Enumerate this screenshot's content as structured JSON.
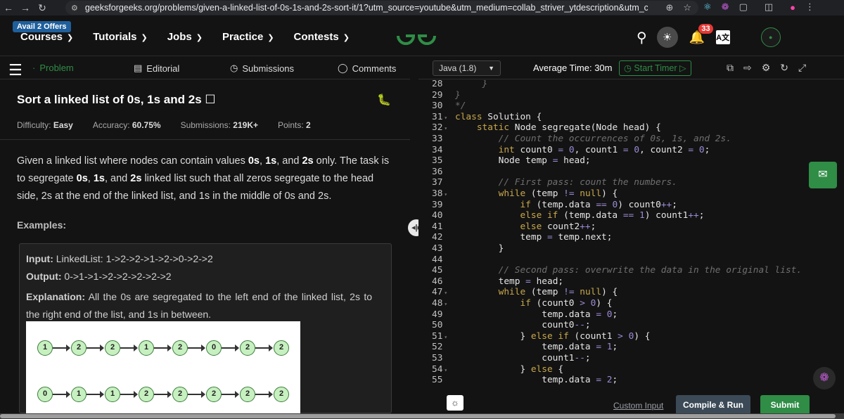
{
  "browser": {
    "url": "geeksforgeeks.org/problems/given-a-linked-list-of-0s-1s-and-2s-sort-it/1?utm_source=youtube&utm_medium=collab_striver_ytdescription&utm_campaign=given-a..."
  },
  "header": {
    "offers_label": "Avail 2 Offers",
    "menu": [
      "Courses",
      "Tutorials",
      "Jobs",
      "Practice",
      "Contests"
    ],
    "logo_text": "GfG",
    "notification_count": "33",
    "language_label": "A文"
  },
  "problem_tabs": {
    "problem": "Problem",
    "editorial": "Editorial",
    "submissions": "Submissions",
    "comments": "Comments"
  },
  "problem": {
    "title": "Sort a linked list of 0s, 1s and 2s",
    "difficulty_label": "Difficulty:",
    "difficulty_value": "Easy",
    "accuracy_label": "Accuracy:",
    "accuracy_value": "60.75%",
    "submissions_label": "Submissions:",
    "submissions_value": "219K+",
    "points_label": "Points:",
    "points_value": "2",
    "description": [
      {
        "t": "Given a linked list where nodes can contain values ",
        "b": false
      },
      {
        "t": "0s",
        "b": true
      },
      {
        "t": ", ",
        "b": false
      },
      {
        "t": "1s",
        "b": true
      },
      {
        "t": ", and ",
        "b": false
      },
      {
        "t": "2s",
        "b": true
      },
      {
        "t": " only. The task is to segregate ",
        "b": false
      },
      {
        "t": "0s",
        "b": true
      },
      {
        "t": ", ",
        "b": false
      },
      {
        "t": "1s",
        "b": true
      },
      {
        "t": ", and ",
        "b": false
      },
      {
        "t": "2s",
        "b": true
      },
      {
        "t": " linked list such that all zeros segregate to the head side, 2s at the end of the linked list, and 1s in the middle of 0s and 2s.",
        "b": false
      }
    ],
    "examples_label": "Examples:",
    "example": {
      "input_label": "Input:",
      "input_value": "LinkedList: 1->2->2->1->2->0->2->2",
      "output_label": "Output:",
      "output_value": "0->1->1->2->2->2->2->2",
      "explanation_label": "Explanation:",
      "explanation_value": "All the 0s are segregated to the left end of the linked list, 2s to the right end of the list, and 1s in between.",
      "row1": [
        "1",
        "2",
        "2",
        "1",
        "2",
        "0",
        "2",
        "2"
      ],
      "row2": [
        "0",
        "1",
        "1",
        "2",
        "2",
        "2",
        "2",
        "2"
      ]
    }
  },
  "editor": {
    "language": "Java (1.8)",
    "average_time": "Average Time: 30m",
    "start_timer": "Start Timer",
    "custom_input": "Custom Input",
    "compile_run": "Compile & Run",
    "submit": "Submit",
    "lines": [
      {
        "n": "28",
        "fold": false,
        "code": [
          {
            "c": "     }",
            "k": "cm"
          }
        ]
      },
      {
        "n": "29",
        "fold": false,
        "code": [
          {
            "c": "}",
            "k": "cm"
          }
        ]
      },
      {
        "n": "30",
        "fold": false,
        "code": [
          {
            "c": "*/",
            "k": "cm"
          }
        ]
      },
      {
        "n": "31",
        "fold": true,
        "code": [
          {
            "c": "class",
            "k": "kw"
          },
          {
            "c": " Solution {",
            "k": ""
          }
        ]
      },
      {
        "n": "32",
        "fold": true,
        "code": [
          {
            "c": "    ",
            "k": ""
          },
          {
            "c": "static",
            "k": "kw"
          },
          {
            "c": " Node segregate(Node head) {",
            "k": ""
          }
        ]
      },
      {
        "n": "33",
        "fold": false,
        "code": [
          {
            "c": "        // Count the occurrences of 0s, 1s, and 2s.",
            "k": "cm"
          }
        ]
      },
      {
        "n": "34",
        "fold": false,
        "code": [
          {
            "c": "        ",
            "k": ""
          },
          {
            "c": "int",
            "k": "kw"
          },
          {
            "c": " count0 ",
            "k": ""
          },
          {
            "c": "=",
            "k": "op"
          },
          {
            "c": " ",
            "k": ""
          },
          {
            "c": "0",
            "k": "num"
          },
          {
            "c": ", count1 ",
            "k": ""
          },
          {
            "c": "=",
            "k": "op"
          },
          {
            "c": " ",
            "k": ""
          },
          {
            "c": "0",
            "k": "num"
          },
          {
            "c": ", count2 ",
            "k": ""
          },
          {
            "c": "=",
            "k": "op"
          },
          {
            "c": " ",
            "k": ""
          },
          {
            "c": "0",
            "k": "num"
          },
          {
            "c": ";",
            "k": ""
          }
        ]
      },
      {
        "n": "35",
        "fold": false,
        "code": [
          {
            "c": "        Node temp ",
            "k": ""
          },
          {
            "c": "=",
            "k": "op"
          },
          {
            "c": " head;",
            "k": ""
          }
        ]
      },
      {
        "n": "36",
        "fold": false,
        "code": [
          {
            "c": "",
            "k": ""
          }
        ]
      },
      {
        "n": "37",
        "fold": false,
        "code": [
          {
            "c": "        // First pass: count the numbers.",
            "k": "cm"
          }
        ]
      },
      {
        "n": "38",
        "fold": true,
        "code": [
          {
            "c": "        ",
            "k": ""
          },
          {
            "c": "while",
            "k": "kw"
          },
          {
            "c": " (temp ",
            "k": ""
          },
          {
            "c": "!=",
            "k": "op"
          },
          {
            "c": " ",
            "k": ""
          },
          {
            "c": "null",
            "k": "kw"
          },
          {
            "c": ") {",
            "k": ""
          }
        ]
      },
      {
        "n": "39",
        "fold": false,
        "code": [
          {
            "c": "            ",
            "k": ""
          },
          {
            "c": "if",
            "k": "kw"
          },
          {
            "c": " (temp.data ",
            "k": ""
          },
          {
            "c": "==",
            "k": "op"
          },
          {
            "c": " ",
            "k": ""
          },
          {
            "c": "0",
            "k": "num"
          },
          {
            "c": ") count0",
            "k": ""
          },
          {
            "c": "++",
            "k": "op"
          },
          {
            "c": ";",
            "k": ""
          }
        ]
      },
      {
        "n": "40",
        "fold": false,
        "code": [
          {
            "c": "            ",
            "k": ""
          },
          {
            "c": "else if",
            "k": "kw"
          },
          {
            "c": " (temp.data ",
            "k": ""
          },
          {
            "c": "==",
            "k": "op"
          },
          {
            "c": " ",
            "k": ""
          },
          {
            "c": "1",
            "k": "num"
          },
          {
            "c": ") count1",
            "k": ""
          },
          {
            "c": "++",
            "k": "op"
          },
          {
            "c": ";",
            "k": ""
          }
        ]
      },
      {
        "n": "41",
        "fold": false,
        "code": [
          {
            "c": "            ",
            "k": ""
          },
          {
            "c": "else",
            "k": "kw"
          },
          {
            "c": " count2",
            "k": ""
          },
          {
            "c": "++",
            "k": "op"
          },
          {
            "c": ";",
            "k": ""
          }
        ]
      },
      {
        "n": "42",
        "fold": false,
        "code": [
          {
            "c": "            temp ",
            "k": ""
          },
          {
            "c": "=",
            "k": "op"
          },
          {
            "c": " temp.next;",
            "k": ""
          }
        ]
      },
      {
        "n": "43",
        "fold": false,
        "code": [
          {
            "c": "        }",
            "k": ""
          }
        ]
      },
      {
        "n": "44",
        "fold": false,
        "code": [
          {
            "c": "",
            "k": ""
          }
        ]
      },
      {
        "n": "45",
        "fold": false,
        "code": [
          {
            "c": "        // Second pass: overwrite the data in the original list.",
            "k": "cm"
          }
        ]
      },
      {
        "n": "46",
        "fold": false,
        "code": [
          {
            "c": "        temp ",
            "k": ""
          },
          {
            "c": "=",
            "k": "op"
          },
          {
            "c": " head;",
            "k": ""
          }
        ]
      },
      {
        "n": "47",
        "fold": true,
        "code": [
          {
            "c": "        ",
            "k": ""
          },
          {
            "c": "while",
            "k": "kw"
          },
          {
            "c": " (temp ",
            "k": ""
          },
          {
            "c": "!=",
            "k": "op"
          },
          {
            "c": " ",
            "k": ""
          },
          {
            "c": "null",
            "k": "kw"
          },
          {
            "c": ") {",
            "k": ""
          }
        ]
      },
      {
        "n": "48",
        "fold": true,
        "code": [
          {
            "c": "            ",
            "k": ""
          },
          {
            "c": "if",
            "k": "kw"
          },
          {
            "c": " (count0 ",
            "k": ""
          },
          {
            "c": ">",
            "k": "op"
          },
          {
            "c": " ",
            "k": ""
          },
          {
            "c": "0",
            "k": "num"
          },
          {
            "c": ") {",
            "k": ""
          }
        ]
      },
      {
        "n": "49",
        "fold": false,
        "code": [
          {
            "c": "                temp.data ",
            "k": ""
          },
          {
            "c": "=",
            "k": "op"
          },
          {
            "c": " ",
            "k": ""
          },
          {
            "c": "0",
            "k": "num"
          },
          {
            "c": ";",
            "k": ""
          }
        ]
      },
      {
        "n": "50",
        "fold": false,
        "code": [
          {
            "c": "                count0",
            "k": ""
          },
          {
            "c": "--",
            "k": "op"
          },
          {
            "c": ";",
            "k": ""
          }
        ]
      },
      {
        "n": "51",
        "fold": true,
        "code": [
          {
            "c": "            } ",
            "k": ""
          },
          {
            "c": "else if",
            "k": "kw"
          },
          {
            "c": " (count1 ",
            "k": ""
          },
          {
            "c": ">",
            "k": "op"
          },
          {
            "c": " ",
            "k": ""
          },
          {
            "c": "0",
            "k": "num"
          },
          {
            "c": ") {",
            "k": ""
          }
        ]
      },
      {
        "n": "52",
        "fold": false,
        "code": [
          {
            "c": "                temp.data ",
            "k": ""
          },
          {
            "c": "=",
            "k": "op"
          },
          {
            "c": " ",
            "k": ""
          },
          {
            "c": "1",
            "k": "num"
          },
          {
            "c": ";",
            "k": ""
          }
        ]
      },
      {
        "n": "53",
        "fold": false,
        "code": [
          {
            "c": "                count1",
            "k": ""
          },
          {
            "c": "--",
            "k": "op"
          },
          {
            "c": ";",
            "k": ""
          }
        ]
      },
      {
        "n": "54",
        "fold": true,
        "code": [
          {
            "c": "            } ",
            "k": ""
          },
          {
            "c": "else",
            "k": "kw"
          },
          {
            "c": " {",
            "k": ""
          }
        ]
      },
      {
        "n": "55",
        "fold": false,
        "code": [
          {
            "c": "                temp.data ",
            "k": ""
          },
          {
            "c": "=",
            "k": "op"
          },
          {
            "c": " ",
            "k": ""
          },
          {
            "c": "2",
            "k": "num"
          },
          {
            "c": ";",
            "k": ""
          }
        ]
      }
    ]
  },
  "icons": {
    "back": "arrow-left-icon",
    "forward": "arrow-right-icon",
    "reload": "reload-icon",
    "search": "search-icon",
    "theme": "sun-icon",
    "notifications": "bell-icon",
    "bug": "bug-icon",
    "chat": "chat-icon",
    "ai": "brain-icon"
  },
  "colors": {
    "brand_green": "#2f8d46",
    "background": "#131313",
    "keyword": "#c9a84c",
    "comment": "#6f6f6f",
    "number": "#9c8bd6"
  }
}
